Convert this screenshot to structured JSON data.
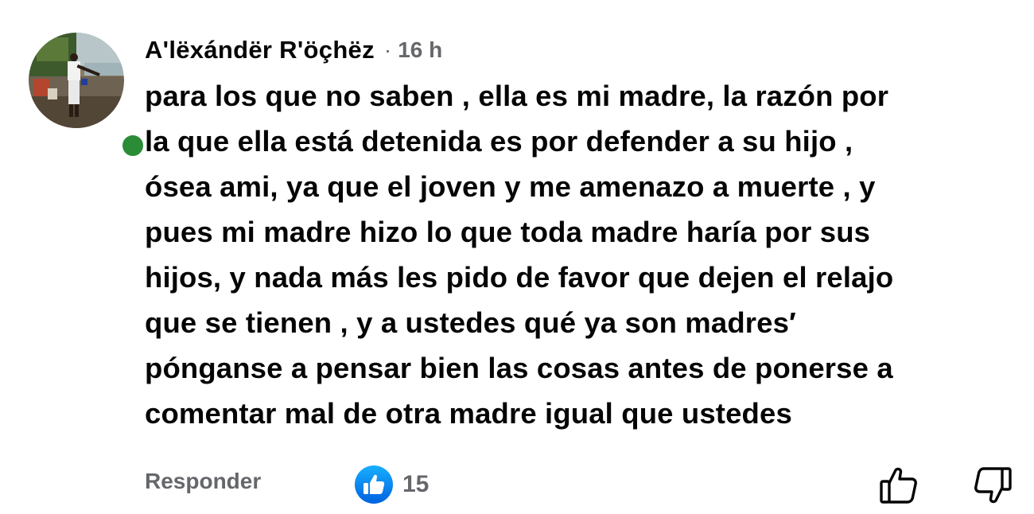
{
  "comment": {
    "author": "A'lëxándër R'öçhëz",
    "meta_separator": "·",
    "time": "16 h",
    "online": true,
    "body_lines": [
      "para los que no saben , ella es mi madre, la razón por",
      "la que ella está detenida es por defender a su hijo ,",
      "ósea ami, ya que el joven y me amenazo a muerte , y",
      "pues mi madre hizo lo que toda madre haría por sus",
      "hijos, y nada más les pido de favor que dejen el relajo",
      "que se tienen , y a ustedes qué ya son madres′",
      "pónganse a pensar bien las cosas antes de ponerse a",
      "comentar mal de otra madre igual que ustedes"
    ]
  },
  "actions": {
    "reply_label": "Responder",
    "reaction_count": "15",
    "reaction_icon": "like-icon",
    "upvote_icon": "thumbs-up-outline-icon",
    "downvote_icon": "thumbs-down-outline-icon"
  },
  "colors": {
    "text": "#050505",
    "secondary": "#65676b",
    "like_blue": "#1877f2",
    "online_green": "#2a8c36"
  }
}
